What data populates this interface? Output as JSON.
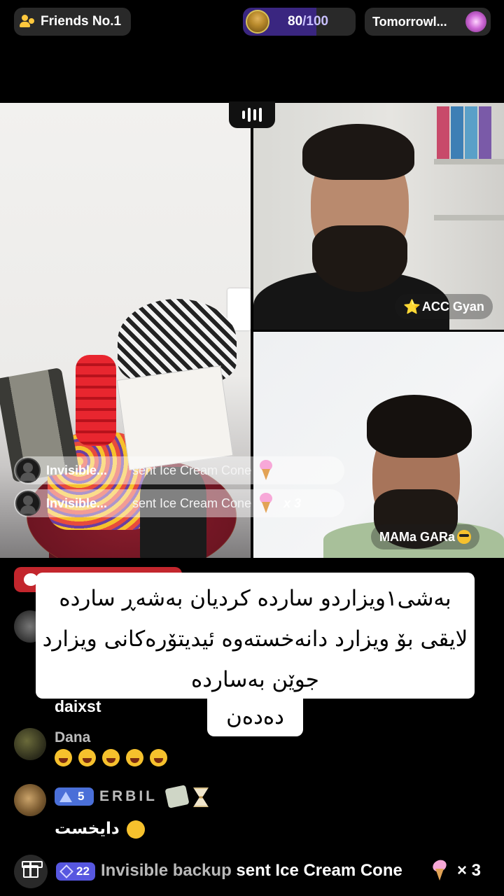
{
  "top_bar": {
    "friends_label": "Friends No.1",
    "score_value": "80",
    "score_separator": "/",
    "score_max": "100",
    "score_progress": 0.8,
    "event_label": "Tomorrowl...",
    "icons": [
      "friends-icon",
      "host-avatar",
      "tomorrowland-logo"
    ]
  },
  "video": {
    "participant_top": {
      "star": "⭐",
      "name": "ACC Gyan"
    },
    "participant_bottom": {
      "name": "MAMa GARa"
    }
  },
  "gift_notifications": [
    {
      "sender": "Invisible...",
      "action": "sent Ice Cream Cone",
      "multiplier": ""
    },
    {
      "sender": "Invisible...",
      "action": "sent Ice Cream Cone",
      "multiplier": "x 3"
    }
  ],
  "chat": {
    "messages": [
      {
        "user": "",
        "text": "daixst"
      },
      {
        "user": "Dana",
        "text": "😂😂😂😂😂"
      },
      {
        "user": "ERBIL",
        "level": "5",
        "text": "دایخست"
      }
    ]
  },
  "caption": {
    "line1": "بەشی١ویزاردو سارده کردیان بەشەڕ سارده لایقی بۆ ویزارد دانەخستەوە ئیدیتۆرەکانی ویزارد جوێن بەسارده",
    "line2": "دەدەن"
  },
  "bottom_bar": {
    "level": "22",
    "sender": "Invisible backup",
    "action": "sent Ice Cream Cone",
    "multiplier": "× 3"
  },
  "colors": {
    "background": "#000000",
    "score_fill": "#3a2680",
    "level_badge": "#4a6fd8",
    "level_badge_22": "#5757e0",
    "live_badge_red": "#c3262d"
  }
}
